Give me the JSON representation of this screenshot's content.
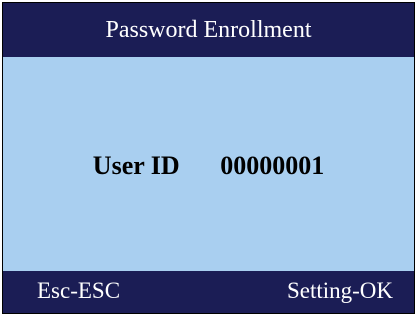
{
  "header": {
    "title": "Password Enrollment"
  },
  "main": {
    "user_id_label": "User ID",
    "user_id_value": "00000001"
  },
  "footer": {
    "left_action": "Esc-ESC",
    "right_action": "Setting-OK"
  },
  "colors": {
    "bar_background": "#1b1d55",
    "content_background": "#a9cff0",
    "bar_text": "#ffffff",
    "content_text": "#000000"
  }
}
